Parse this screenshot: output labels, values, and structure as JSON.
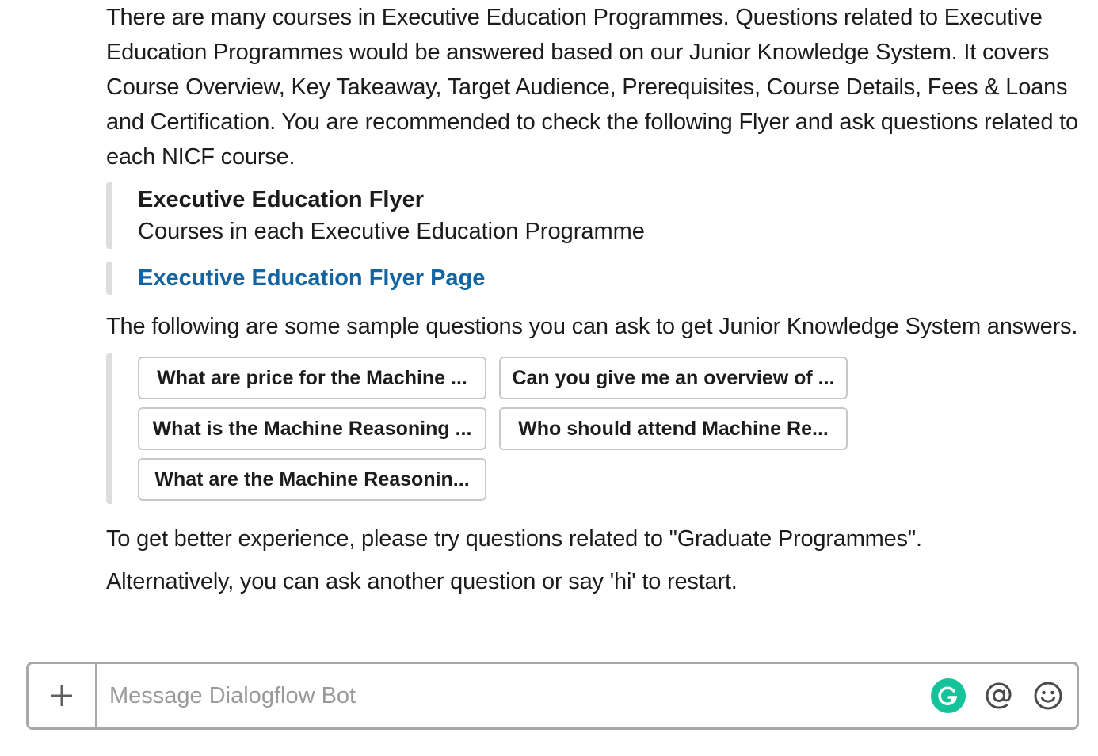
{
  "message": {
    "intro": "There are many courses in Executive Education Programmes. Questions related to Executive Education Programmes would be answered based on our Junior Knowledge System. It covers Course Overview, Key Takeaway, Target Audience, Prerequisites, Course Details, Fees & Loans and Certification. You are recommended to check the following Flyer and ask questions related to each NICF course.",
    "flyer": {
      "title": "Executive Education Flyer",
      "subtitle": "Courses in each Executive Education Programme"
    },
    "flyer_link": "Executive Education Flyer Page",
    "sample_intro": "The following are some sample questions you can ask to get Junior Knowledge System answers.",
    "questions": [
      "What are price for the Machine ...",
      "Can you give me an overview of ...",
      "What is the Machine Reasoning ...",
      "Who should attend Machine Re...",
      "What are the Machine Reasonin..."
    ],
    "suggestion": "To get better experience, please try questions related to \"Graduate Programmes\".",
    "restart": "Alternatively, you can ask another question or say 'hi' to restart."
  },
  "composer": {
    "placeholder": "Message Dialogflow Bot",
    "value": ""
  },
  "icons": {
    "add": "plus-icon",
    "grammarly": "grammarly-icon",
    "mention": "at-sign-icon",
    "emoji": "smiley-icon"
  },
  "colors": {
    "link": "#1264a3",
    "grammarly": "#15c39a",
    "attachment_bar": "#dddddd",
    "border": "#a8a8a8"
  }
}
